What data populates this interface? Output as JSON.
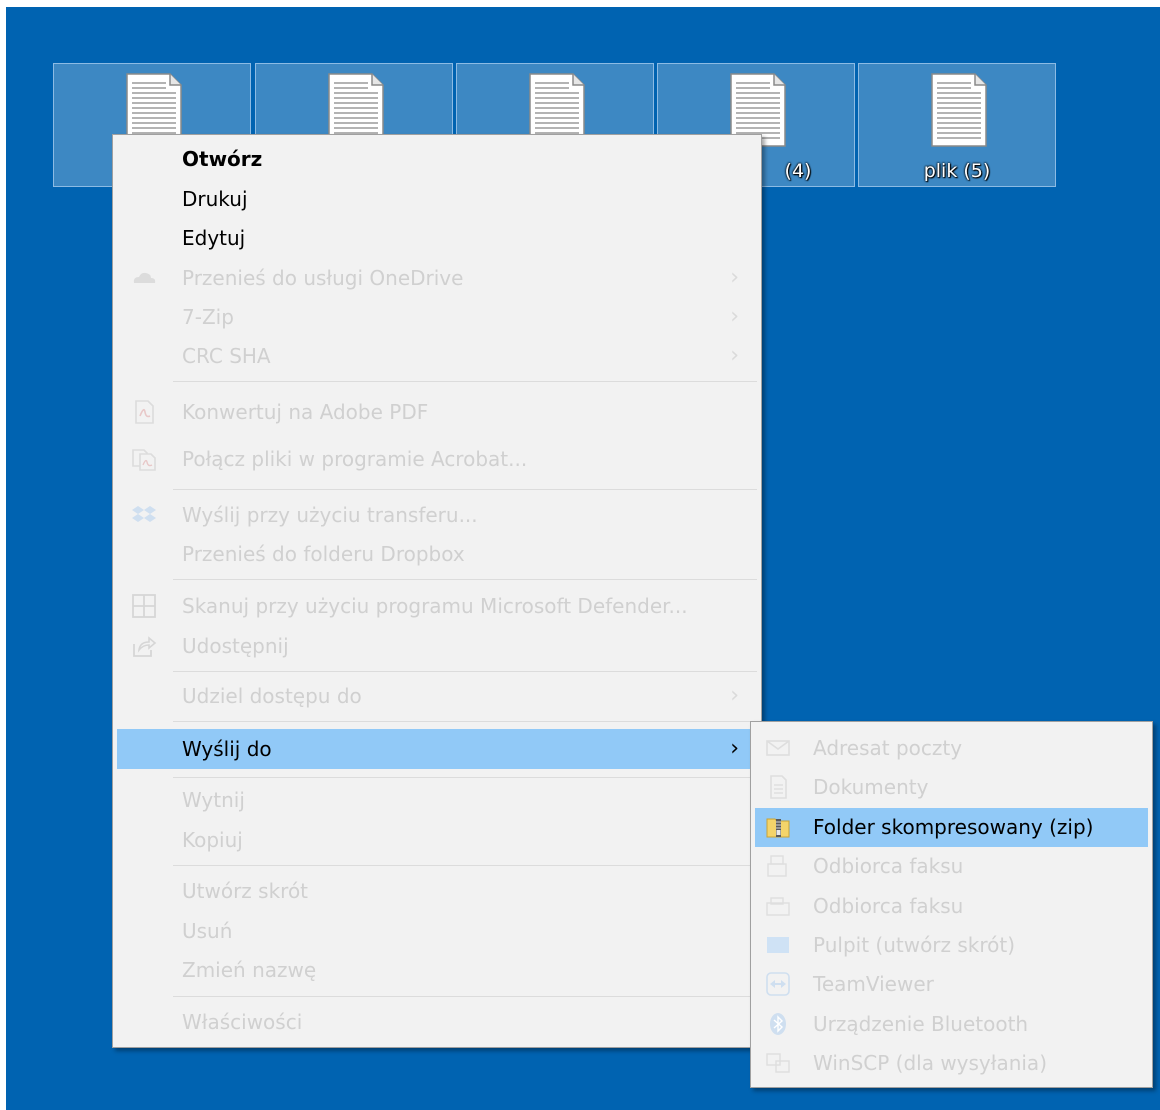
{
  "desktop": {
    "background_color": "#0063b1",
    "files": [
      {
        "label": ""
      },
      {
        "label": ""
      },
      {
        "label": ""
      },
      {
        "label": "(4)"
      },
      {
        "label": "plik (5)"
      }
    ]
  },
  "context_menu": {
    "items": [
      {
        "label": "Otwórz"
      },
      {
        "label": "Drukuj"
      },
      {
        "label": "Edytuj"
      },
      {
        "label": "Przenieś do usługi OneDrive",
        "icon": "onedrive-icon"
      },
      {
        "label": "7-Zip"
      },
      {
        "label": "CRC SHA"
      },
      {
        "label": "Konwertuj na Adobe PDF",
        "icon": "pdf-icon"
      },
      {
        "label": "Połącz pliki w programie Acrobat...",
        "icon": "acrobat-combine-icon"
      },
      {
        "label": "Wyślij przy użyciu transferu...",
        "icon": "dropbox-icon"
      },
      {
        "label": "Przenieś do folderu Dropbox"
      },
      {
        "label": "Skanuj przy użyciu programu Microsoft Defender...",
        "icon": "defender-icon"
      },
      {
        "label": "Udostępnij",
        "icon": "share-icon"
      },
      {
        "label": "Udziel dostępu do"
      },
      {
        "label": "Wyślij do"
      },
      {
        "label": "Wytnij"
      },
      {
        "label": "Kopiuj"
      },
      {
        "label": "Utwórz skrót"
      },
      {
        "label": "Usuń"
      },
      {
        "label": "Zmień nazwę"
      },
      {
        "label": "Właściwości"
      }
    ],
    "submenu_chevron": "›"
  },
  "send_to_menu": {
    "items": [
      {
        "label": "Adresat poczty",
        "icon": "mail-icon"
      },
      {
        "label": "Dokumenty",
        "icon": "documents-icon"
      },
      {
        "label": "Folder skompresowany (zip)",
        "icon": "zip-folder-icon"
      },
      {
        "label": "Odbiorca faksu",
        "icon": "fax-icon"
      },
      {
        "label": "Odbiorca faksu",
        "icon": "fax-machine-icon"
      },
      {
        "label": "Pulpit (utwórz skrót)",
        "icon": "desktop-icon"
      },
      {
        "label": "TeamViewer",
        "icon": "teamviewer-icon"
      },
      {
        "label": "Urządzenie Bluetooth",
        "icon": "bluetooth-icon"
      },
      {
        "label": "WinSCP (dla wysyłania)",
        "icon": "winscp-icon"
      }
    ]
  },
  "colors": {
    "highlight": "#91c9f7",
    "menu_bg": "#f2f2f2",
    "disabled_text": "#d0d0d0"
  }
}
